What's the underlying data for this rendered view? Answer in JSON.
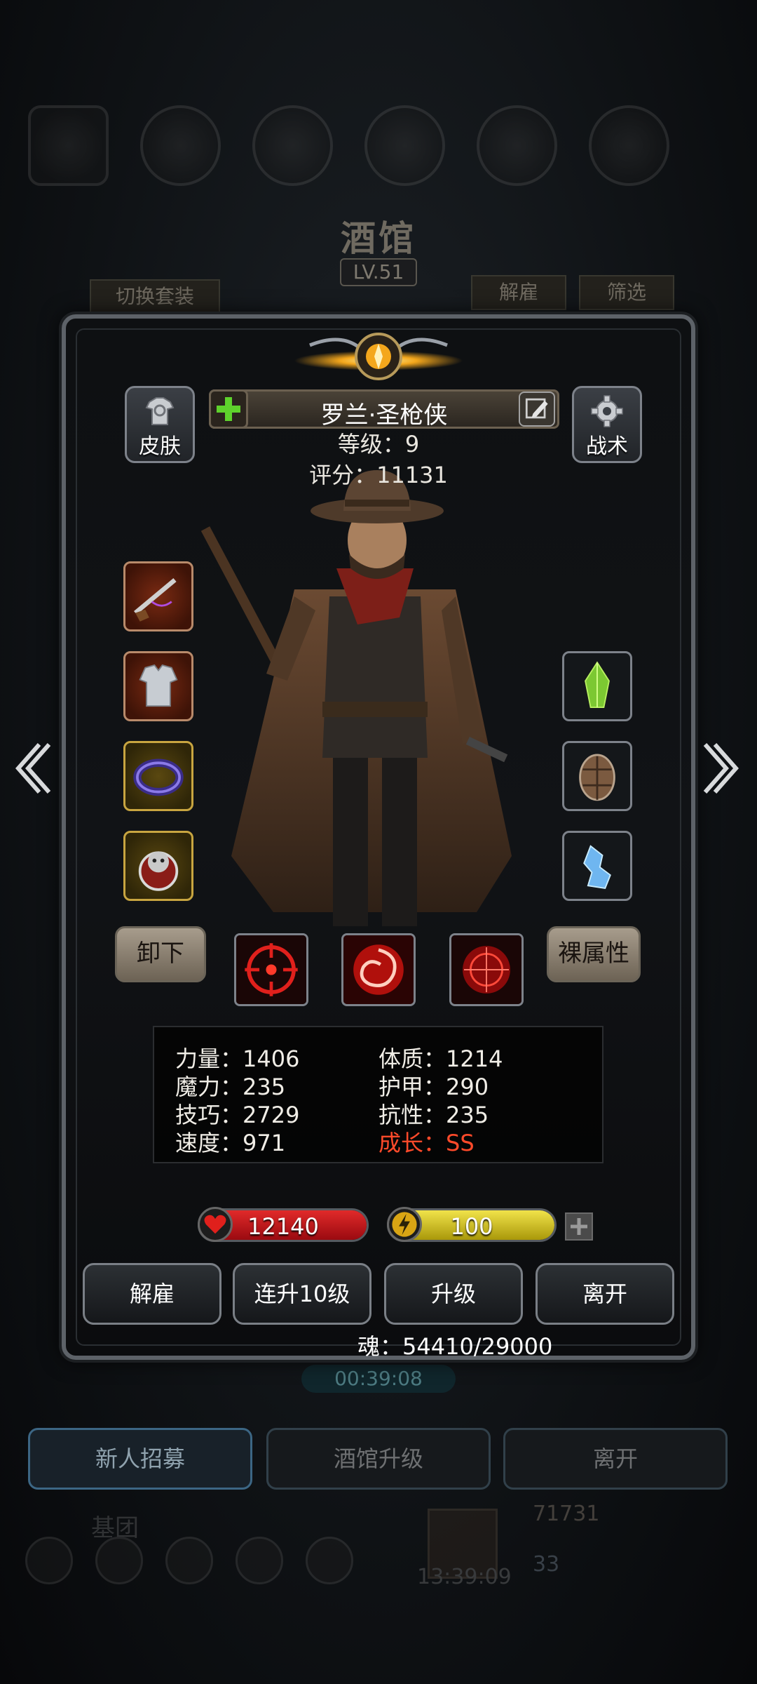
{
  "background": {
    "tavern_title": "酒馆",
    "tavern_level": "LV.51",
    "switch_outfit": "切换套装",
    "dismiss": "解雇",
    "filter": "筛选",
    "timer": "00:39:08",
    "recruit": "新人招募",
    "upgrade_tavern": "酒馆升级",
    "leave": "离开",
    "group": "基团",
    "clock": "13:39:09",
    "gold": "71731",
    "gems": "33"
  },
  "hero": {
    "name": "罗兰·圣枪侠",
    "level_line": "等级：9",
    "score_line": "评分：11131"
  },
  "buttons": {
    "skin": "皮肤",
    "tactics": "战术",
    "unequip": "卸下",
    "base_stats": "裸属性",
    "dismiss": "解雇",
    "level_up_10": "连升10级",
    "level_up": "升级",
    "leave": "离开"
  },
  "stats": {
    "strength": "力量：1406",
    "constitution": "体质：1214",
    "magic": "魔力：235",
    "armor": "护甲：290",
    "skill": "技巧：2729",
    "resistance": "抗性：235",
    "speed": "速度：971",
    "growth": "成长：SS"
  },
  "resources": {
    "hp": "12140",
    "energy": "100",
    "soul": "魂：54410/29000"
  },
  "equipment": {
    "left": [
      "musket-icon",
      "armor-icon",
      "ring-icon",
      "amulet-icon"
    ],
    "right": [
      "green-crystal-icon",
      "turtle-shell-icon",
      "ice-shard-icon"
    ]
  },
  "colors": {
    "growth": "#ff4a2a",
    "hp_bar": "#c4101a",
    "energy_bar": "#d9c814"
  }
}
